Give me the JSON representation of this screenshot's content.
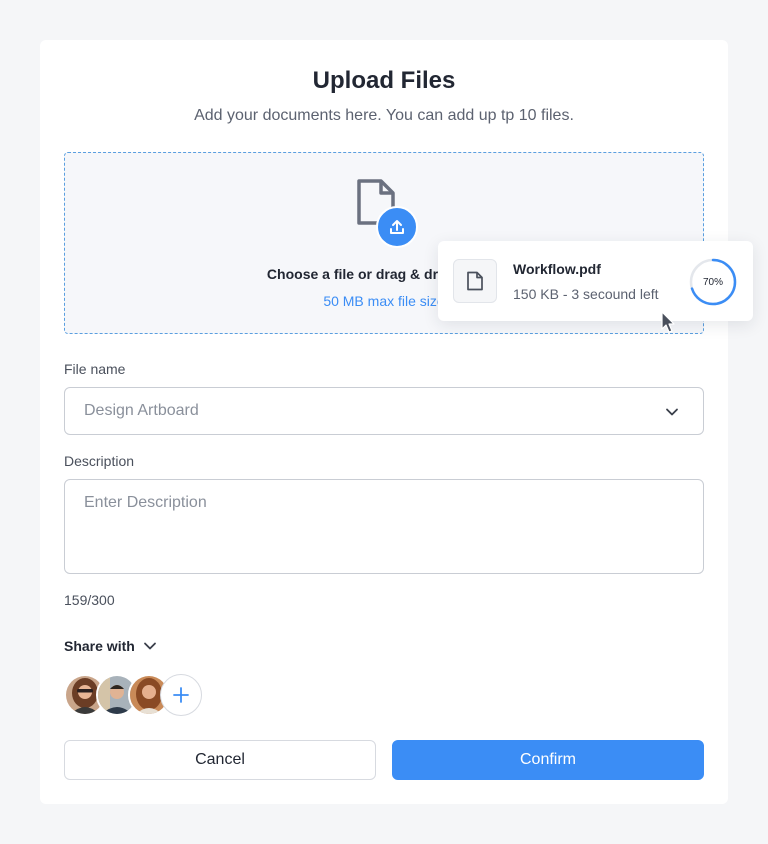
{
  "dialog": {
    "title": "Upload Files",
    "subtitle": "Add your documents here. You can add up tp 10 files."
  },
  "dropzone": {
    "text": "Choose a file or drag & drop it here",
    "limit": "50 MB max file size"
  },
  "upload": {
    "filename": "Workflow.pdf",
    "meta": "150 KB - 3 secound left",
    "progress_label": "70%",
    "progress": 0.7
  },
  "file_name": {
    "label": "File name",
    "value": "Design Artboard"
  },
  "description": {
    "label": "Description",
    "placeholder": "Enter Description",
    "counter": "159/300"
  },
  "share": {
    "label": "Share with",
    "avatars": [
      "avatar-1",
      "avatar-2",
      "avatar-3"
    ]
  },
  "actions": {
    "cancel": "Cancel",
    "confirm": "Confirm"
  },
  "colors": {
    "accent": "#3b8df5",
    "border": "#c9cdd4",
    "background": "#f5f6f8"
  }
}
